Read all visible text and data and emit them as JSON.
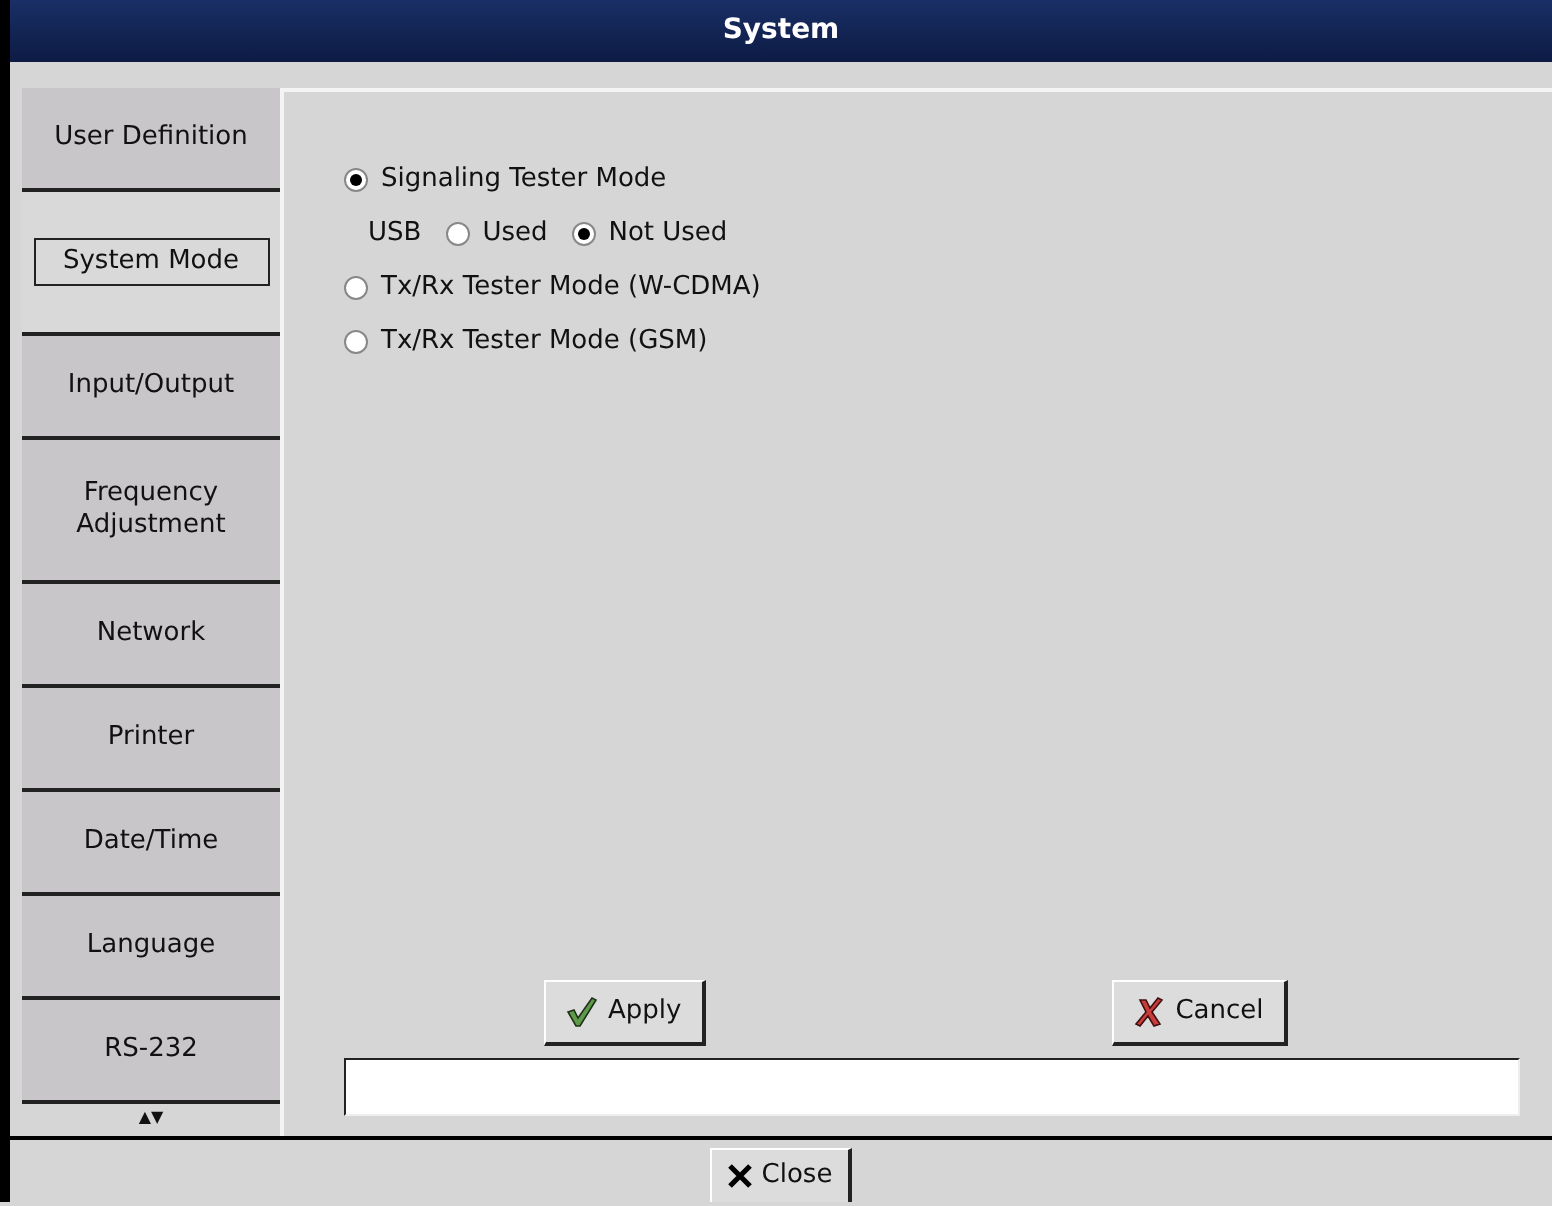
{
  "window": {
    "title": "System"
  },
  "sidebar": {
    "items": [
      {
        "label": "User Definition",
        "selected": false
      },
      {
        "label": "System Mode",
        "selected": true
      },
      {
        "label": "Input/Output",
        "selected": false
      },
      {
        "label": "Frequency Adjustment",
        "selected": false
      },
      {
        "label": "Network",
        "selected": false
      },
      {
        "label": "Printer",
        "selected": false
      },
      {
        "label": "Date/Time",
        "selected": false
      },
      {
        "label": "Language",
        "selected": false
      },
      {
        "label": "RS-232",
        "selected": false
      }
    ],
    "scroll_arrows": "▲▼"
  },
  "modes": [
    {
      "kind": "mode",
      "label": "Signaling Tester Mode",
      "selected": true
    },
    {
      "kind": "usb",
      "label": "USB",
      "options": [
        {
          "label": "Used",
          "selected": false
        },
        {
          "label": "Not Used",
          "selected": true
        }
      ]
    },
    {
      "kind": "mode",
      "label": "Tx/Rx Tester Mode (W-CDMA)",
      "selected": false
    },
    {
      "kind": "mode",
      "label": "Tx/Rx Tester Mode (GSM)",
      "selected": false
    }
  ],
  "buttons": [
    {
      "kind": "apply",
      "label": "Apply"
    },
    {
      "kind": "cancel",
      "label": "Cancel"
    }
  ],
  "footer_button": {
    "label": "Close"
  }
}
